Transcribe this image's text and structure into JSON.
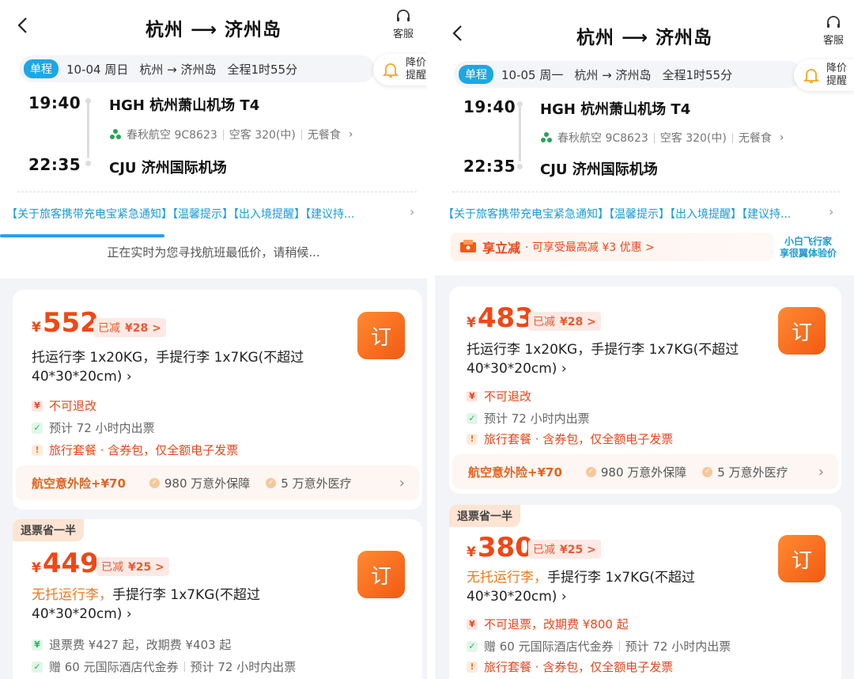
{
  "header": {
    "title": "杭州 ⟶ 济州岛",
    "service_label": "客服"
  },
  "price_alert": {
    "label": "降价提醒"
  },
  "left": {
    "trip_type": "单程",
    "date": "10-04 周日",
    "route": "杭州 → 济州岛",
    "duration": "全程1时55分",
    "depart_time": "19:40",
    "depart_airport": "HGH 杭州萧山机场 T4",
    "airline": "春秋航空 9C8623",
    "aircraft": "空客 320(中)",
    "meal": "无餐食",
    "arrive_time": "22:35",
    "arrive_airport": "CJU 济州国际机场",
    "notice": "【关于旅客携带充电宝紧急通知】【温馨提示】【出入境提醒】【建议持...",
    "searching_text": "正在实时为您寻找航班最低价，请稍候...",
    "offers": [
      {
        "price": "552",
        "discount_label": "已减",
        "discount_value": "¥28 >",
        "baggage": "托运行李 1x20KG，手提行李 1x7KG(不超过",
        "baggage_line2": "40*30*20cm) ›",
        "refund": "不可退改",
        "ticketing": "预计 72 小时内出票",
        "package": "旅行套餐 · 含券包，仅全额电子发票",
        "insurance_main": "航空意外险+¥70",
        "insurance_1": "980 万意外保障",
        "insurance_2": "5 万意外医疗"
      },
      {
        "tag": "退票省一半",
        "price": "449",
        "discount_label": "已减",
        "discount_value": "¥25 >",
        "baggage_orange": "无托运行李，",
        "baggage": "手提行李 1x7KG(不超过",
        "baggage_line2": "40*30*20cm) ›",
        "refund": "退票费 ¥427 起，改期费 ¥403 起",
        "voucher": "赠 60 元国际酒店代金券",
        "ticketing": "预计 72 小时内出票"
      }
    ]
  },
  "right": {
    "trip_type": "单程",
    "date": "10-05 周一",
    "route": "杭州 → 济州岛",
    "duration": "全程1时55分",
    "depart_time": "19:40",
    "depart_airport": "HGH 杭州萧山机场 T4",
    "airline": "春秋航空 9C8623",
    "aircraft": "空客 320(中)",
    "meal": "无餐食",
    "arrive_time": "22:35",
    "arrive_airport": "CJU 济州国际机场",
    "notice": "【关于旅客携带充电宝紧急通知】【温馨提示】【出入境提醒】【建议持...",
    "promo_strong": "享立减",
    "promo_desc": "· 可享受最高减 ¥3 优惠  >",
    "promo_side_1": "小白飞行家",
    "promo_side_2": "享很翼体验价",
    "offers": [
      {
        "price": "483",
        "discount_label": "已减",
        "discount_value": "¥28 >",
        "baggage": "托运行李 1x20KG，手提行李 1x7KG(不超过",
        "baggage_line2": "40*30*20cm) ›",
        "refund": "不可退改",
        "ticketing": "预计 72 小时内出票",
        "package": "旅行套餐 · 含券包，仅全额电子发票",
        "insurance_main": "航空意外险+¥70",
        "insurance_1": "980 万意外保障",
        "insurance_2": "5 万意外医疗"
      },
      {
        "tag": "退票省一半",
        "price": "380",
        "discount_label": "已减",
        "discount_value": "¥25 >",
        "baggage_orange": "无托运行李，",
        "baggage": "手提行李 1x7KG(不超过",
        "baggage_line2": "40*30*20cm) ›",
        "refund": "不可退票，改期费 ¥800 起",
        "voucher": "赠 60 元国际酒店代金券",
        "ticketing": "预计 72 小时内出票",
        "package": "旅行套餐 · 含券包，仅全额电子发票"
      }
    ]
  },
  "order_label": "订",
  "yen": "¥",
  "colors": {
    "accent": "#f04716",
    "blue": "#1ea7e4",
    "notice": "#1a9bd6"
  }
}
